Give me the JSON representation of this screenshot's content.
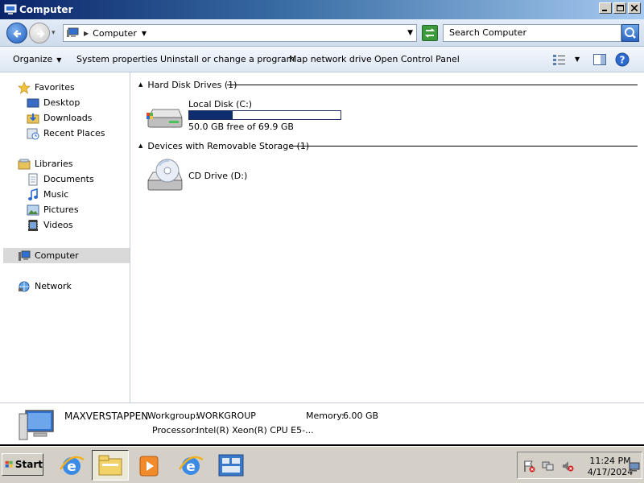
{
  "window": {
    "title": "Computer"
  },
  "addressbar": {
    "breadcrumb": "Computer",
    "search_placeholder": "Search Computer"
  },
  "toolbar": {
    "organize": "Organize",
    "system_properties": "System properties",
    "uninstall": "Uninstall or change a program",
    "map_drive": "Map network drive",
    "control_panel": "Open Control Panel"
  },
  "sidebar": {
    "favorites": "Favorites",
    "desktop": "Desktop",
    "downloads": "Downloads",
    "recent": "Recent Places",
    "libraries": "Libraries",
    "documents": "Documents",
    "music": "Music",
    "pictures": "Pictures",
    "videos": "Videos",
    "computer": "Computer",
    "network": "Network"
  },
  "content": {
    "hdd_group": "Hard Disk Drives (1)",
    "removable_group": "Devices with Removable Storage (1)",
    "local_disk": {
      "name": "Local Disk (C:)",
      "free_text": "50.0 GB free of 69.9 GB",
      "used_fraction": 0.285
    },
    "cd_drive": {
      "name": "CD Drive (D:)"
    }
  },
  "details": {
    "computer_name": "MAXVERSTAPPEN",
    "workgroup_label": "Workgroup:",
    "workgroup": "WORKGROUP",
    "memory_label": "Memory:",
    "memory": "6.00 GB",
    "processor_label": "Processor:",
    "processor": "Intel(R) Xeon(R) CPU E5-..."
  },
  "taskbar": {
    "start": "Start",
    "time": "11:24 PM",
    "date": "4/17/2024"
  },
  "colors": {
    "title_gradient_start": "#0a246a",
    "selection": "#d9d9d9",
    "drive_fill": "#0f2d6e"
  }
}
